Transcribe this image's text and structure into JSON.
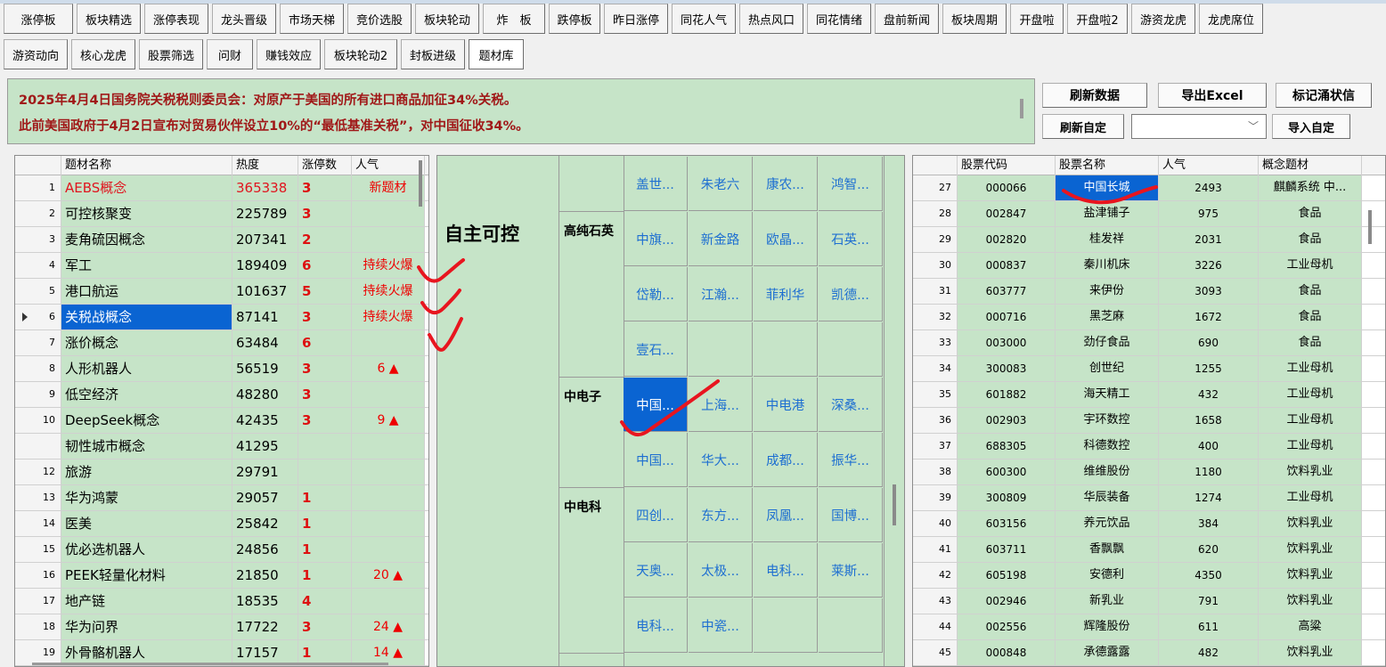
{
  "tabs_row1": [
    "涨停板",
    "板块精选",
    "涨停表现",
    "龙头晋级",
    "市场天梯",
    "竞价选股",
    "板块轮动",
    "炸　板",
    "跌停板",
    "昨日涨停",
    "同花人气",
    "热点风口",
    "同花情绪",
    "盘前新闻",
    "板块周期",
    "开盘啦",
    "开盘啦2",
    "游资龙虎",
    "龙虎席位"
  ],
  "tabs_row2": [
    "游资动向",
    "核心龙虎",
    "股票筛选",
    "问财",
    "赚钱效应",
    "板块轮动2",
    "封板进级",
    "题材库"
  ],
  "news": {
    "line1": "2025年4月4日国务院关税税则委员会：对原产于美国的所有进口商品加征34%关税。",
    "line2": "此前美国政府于4月2日宣布对贸易伙伴设立10%的“最低基准关税”，对中国征收34%。"
  },
  "actions": {
    "refresh": "刷新数据",
    "export": "导出Excel",
    "mark": "标记涌状信",
    "refresh_custom": "刷新自定",
    "import_custom": "导入自定",
    "combo_value": ""
  },
  "left_table": {
    "headers": [
      "题材名称",
      "热度",
      "涨停数",
      "人气"
    ],
    "rows": [
      {
        "idx": "1",
        "name": "AEBS概念",
        "heat": "365338",
        "limit": "3",
        "pop": "新题材"
      },
      {
        "idx": "2",
        "name": "可控核聚变",
        "heat": "225789",
        "limit": "3",
        "pop": ""
      },
      {
        "idx": "3",
        "name": "麦角硫因概念",
        "heat": "207341",
        "limit": "2",
        "pop": ""
      },
      {
        "idx": "4",
        "name": "军工",
        "heat": "189409",
        "limit": "6",
        "pop": "持续火爆"
      },
      {
        "idx": "5",
        "name": "港口航运",
        "heat": "101637",
        "limit": "5",
        "pop": "持续火爆"
      },
      {
        "idx": "6",
        "name": "关税战概念",
        "heat": "87141",
        "limit": "3",
        "pop": "持续火爆"
      },
      {
        "idx": "7",
        "name": "涨价概念",
        "heat": "63484",
        "limit": "6",
        "pop": ""
      },
      {
        "idx": "8",
        "name": "人形机器人",
        "heat": "56519",
        "limit": "3",
        "pop": "6 ▲"
      },
      {
        "idx": "9",
        "name": "低空经济",
        "heat": "48280",
        "limit": "3",
        "pop": ""
      },
      {
        "idx": "10",
        "name": "DeepSeek概念",
        "heat": "42435",
        "limit": "3",
        "pop": "9 ▲"
      },
      {
        "idx": "",
        "name": "韧性城市概念",
        "heat": "41295",
        "limit": "",
        "pop": ""
      },
      {
        "idx": "12",
        "name": "旅游",
        "heat": "29791",
        "limit": "",
        "pop": ""
      },
      {
        "idx": "13",
        "name": "华为鸿蒙",
        "heat": "29057",
        "limit": "1",
        "pop": ""
      },
      {
        "idx": "14",
        "name": "医美",
        "heat": "25842",
        "limit": "1",
        "pop": ""
      },
      {
        "idx": "15",
        "name": "优必选机器人",
        "heat": "24856",
        "limit": "1",
        "pop": ""
      },
      {
        "idx": "16",
        "name": "PEEK轻量化材料",
        "heat": "21850",
        "limit": "1",
        "pop": "20 ▲"
      },
      {
        "idx": "17",
        "name": "地产链",
        "heat": "18535",
        "limit": "4",
        "pop": ""
      },
      {
        "idx": "18",
        "name": "华为问界",
        "heat": "17722",
        "limit": "3",
        "pop": "24 ▲"
      },
      {
        "idx": "19",
        "name": "外骨骼机器人",
        "heat": "17157",
        "limit": "1",
        "pop": "14 ▲"
      }
    ]
  },
  "mid": {
    "main_topic": "自主可控",
    "groups": [
      {
        "name": "",
        "cells": [
          "盖世...",
          "朱老六",
          "康农...",
          "鸿智..."
        ]
      },
      {
        "name": "高纯石英",
        "cells": [
          "中旗...",
          "新金路",
          "欧晶...",
          "石英...",
          "岱勒...",
          "江瀚...",
          "菲利华",
          "凯德...",
          "壹石..."
        ]
      },
      {
        "name": "中电子",
        "cells": [
          "中国...",
          "上海...",
          "中电港",
          "深桑...",
          "中国...",
          "华大...",
          "成都...",
          "振华..."
        ]
      },
      {
        "name": "中电科",
        "cells": [
          "四创...",
          "东方...",
          "凤凰...",
          "国博...",
          "天奥...",
          "太极...",
          "电科...",
          "莱斯...",
          "电科...",
          "中瓷..."
        ]
      }
    ]
  },
  "right_table": {
    "headers": [
      "股票代码",
      "股票名称",
      "人气",
      "概念题材"
    ],
    "rows": [
      {
        "idx": "27",
        "code": "000066",
        "name": "中国长城",
        "pop": "2493",
        "topic": "麒麟系统 中..."
      },
      {
        "idx": "28",
        "code": "002847",
        "name": "盐津铺子",
        "pop": "975",
        "topic": "食品"
      },
      {
        "idx": "29",
        "code": "002820",
        "name": "桂发祥",
        "pop": "2031",
        "topic": "食品"
      },
      {
        "idx": "30",
        "code": "000837",
        "name": "秦川机床",
        "pop": "3226",
        "topic": "工业母机"
      },
      {
        "idx": "31",
        "code": "603777",
        "name": "来伊份",
        "pop": "3093",
        "topic": "食品"
      },
      {
        "idx": "32",
        "code": "000716",
        "name": "黑芝麻",
        "pop": "1672",
        "topic": "食品"
      },
      {
        "idx": "33",
        "code": "003000",
        "name": "劲仔食品",
        "pop": "690",
        "topic": "食品"
      },
      {
        "idx": "34",
        "code": "300083",
        "name": "创世纪",
        "pop": "1255",
        "topic": "工业母机"
      },
      {
        "idx": "35",
        "code": "601882",
        "name": "海天精工",
        "pop": "432",
        "topic": "工业母机"
      },
      {
        "idx": "36",
        "code": "002903",
        "name": "宇环数控",
        "pop": "1658",
        "topic": "工业母机"
      },
      {
        "idx": "37",
        "code": "688305",
        "name": "科德数控",
        "pop": "400",
        "topic": "工业母机"
      },
      {
        "idx": "38",
        "code": "600300",
        "name": "维维股份",
        "pop": "1180",
        "topic": "饮料乳业"
      },
      {
        "idx": "39",
        "code": "300809",
        "name": "华辰装备",
        "pop": "1274",
        "topic": "工业母机"
      },
      {
        "idx": "40",
        "code": "603156",
        "name": "养元饮品",
        "pop": "384",
        "topic": "饮料乳业"
      },
      {
        "idx": "41",
        "code": "603711",
        "name": "香飘飘",
        "pop": "620",
        "topic": "饮料乳业"
      },
      {
        "idx": "42",
        "code": "605198",
        "name": "安德利",
        "pop": "4350",
        "topic": "饮料乳业"
      },
      {
        "idx": "43",
        "code": "002946",
        "name": "新乳业",
        "pop": "791",
        "topic": "饮料乳业"
      },
      {
        "idx": "44",
        "code": "002556",
        "name": "辉隆股份",
        "pop": "611",
        "topic": "高粱"
      },
      {
        "idx": "45",
        "code": "000848",
        "name": "承德露露",
        "pop": "482",
        "topic": "饮料乳业"
      }
    ]
  }
}
